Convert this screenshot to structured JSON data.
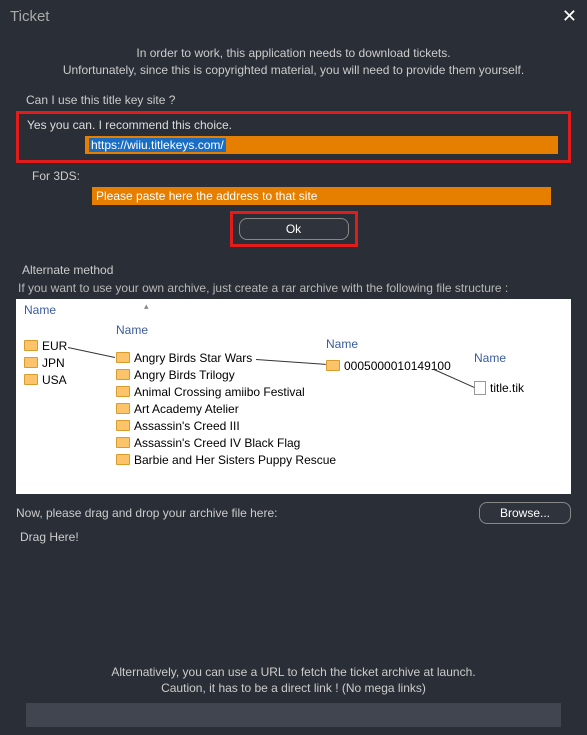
{
  "window": {
    "title": "Ticket"
  },
  "intro": {
    "line1": "In order to work, this application needs to download tickets.",
    "line2": "Unfortunately, since this is copyrighted material, you will need to provide them yourself."
  },
  "section1": {
    "title": "Can I use this title key site ?",
    "recommend": "Yes you can. I recommend this choice.",
    "url": "https://wiiu.titlekeys.com/",
    "for3ds_label": "For 3DS:",
    "placeholder3ds": "Please paste here the address to that site",
    "ok_label": "Ok"
  },
  "alt": {
    "header": "Alternate method",
    "desc": "If you want to use your own archive, just create a rar archive with the following file structure :",
    "col_name": "Name",
    "regions": [
      "EUR",
      "JPN",
      "USA"
    ],
    "titles": [
      "Angry Birds Star Wars",
      "Angry Birds Trilogy",
      "Animal Crossing amiibo Festival",
      "Art Academy Atelier",
      "Assassin's Creed III",
      "Assassin's Creed IV Black Flag",
      "Barbie and Her Sisters Puppy Rescue"
    ],
    "title_id": "0005000010149100",
    "file_name": "title.tik"
  },
  "drag": {
    "label": "Now, please drag and drop your archive file here:",
    "browse": "Browse...",
    "drag_here": "Drag Here!"
  },
  "bottom": {
    "line1": "Alternatively, you can use a URL to fetch the ticket archive at launch.",
    "line2": "Caution, it has to be a direct link ! (No mega links)"
  }
}
